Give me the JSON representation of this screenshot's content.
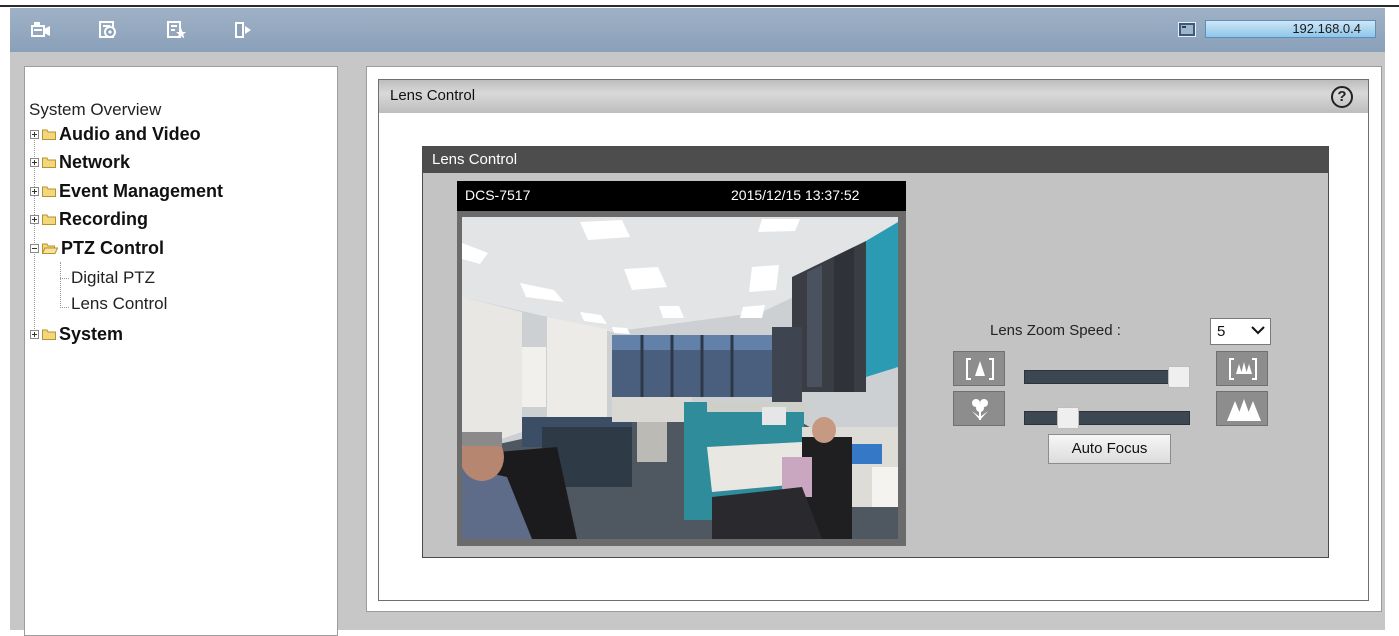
{
  "toolbar": {
    "icons": [
      "live-video-icon",
      "playback-icon",
      "favorites-icon",
      "logout-icon"
    ],
    "ip_address": "192.168.0.4"
  },
  "sidebar": {
    "title": "System Overview",
    "items": [
      {
        "label": "Audio and Video",
        "expanded": false
      },
      {
        "label": "Network",
        "expanded": false
      },
      {
        "label": "Event Management",
        "expanded": false
      },
      {
        "label": "Recording",
        "expanded": false
      },
      {
        "label": "PTZ Control",
        "expanded": true,
        "children": [
          "Digital PTZ",
          "Lens Control"
        ]
      },
      {
        "label": "System",
        "expanded": false
      }
    ]
  },
  "main": {
    "title": "Lens Control",
    "help": "?"
  },
  "lens_control": {
    "title": "Lens Control",
    "camera_name": "DCS-7517",
    "timestamp": "2015/12/15 13:37:52",
    "zoom_speed_label": "Lens Zoom Speed :",
    "zoom_speed_value": "5",
    "zoom_level": 0.97,
    "focus_level": 0.2,
    "auto_focus_label": "Auto Focus"
  },
  "colors": {
    "toolbar": "#8aa0b9",
    "panel_header": "#4d4d4d",
    "slider_track": "#3d4752"
  }
}
